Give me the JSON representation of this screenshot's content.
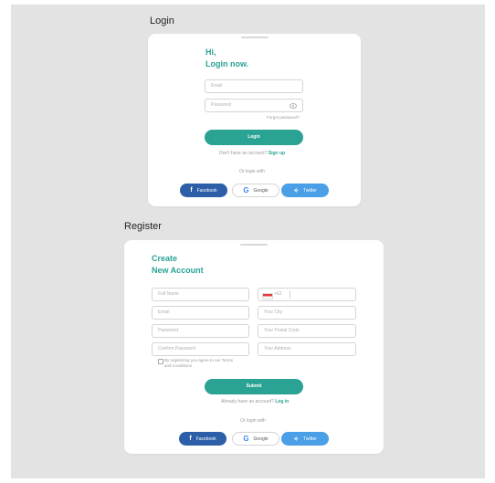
{
  "login_section": {
    "title": "Login",
    "heading_line1": "Hi,",
    "heading_line2": "Login now.",
    "email_placeholder": "Email",
    "password_placeholder": "Password",
    "forgot_password": "Forgot password?",
    "login_button": "Login",
    "no_account_text": "Don't have an account?",
    "signup_link": "Sign up",
    "or_login_with": "Or login with",
    "socials": {
      "facebook": "Facebook",
      "google": "Google",
      "twitter": "Twitter"
    }
  },
  "register_section": {
    "title": "Register",
    "heading_line1": "Create",
    "heading_line2": "New Account",
    "fields": {
      "full_name": "Full Name",
      "phone": "+62",
      "email": "Email",
      "city": "Your City",
      "password": "Password",
      "postal_code": "Your Postal Code",
      "confirm_password": "Confirm Password",
      "address": "Your Address"
    },
    "terms_line1": "By registering you agree to our Terms",
    "terms_line2": "and Conditions",
    "submit_button": "Submit",
    "have_account_text": "Already have an account?",
    "login_link": "Log in",
    "or_login_with": "Or login with",
    "socials": {
      "facebook": "Facebook",
      "google": "Google",
      "twitter": "Twitter"
    }
  },
  "colors": {
    "accent": "#2aa294",
    "facebook": "#2d5fa8",
    "twitter": "#4a9fe6",
    "background": "#e3e3e3"
  },
  "icons": [
    "eye-icon",
    "facebook-icon",
    "google-icon",
    "twitter-icon",
    "flag-icon"
  ]
}
